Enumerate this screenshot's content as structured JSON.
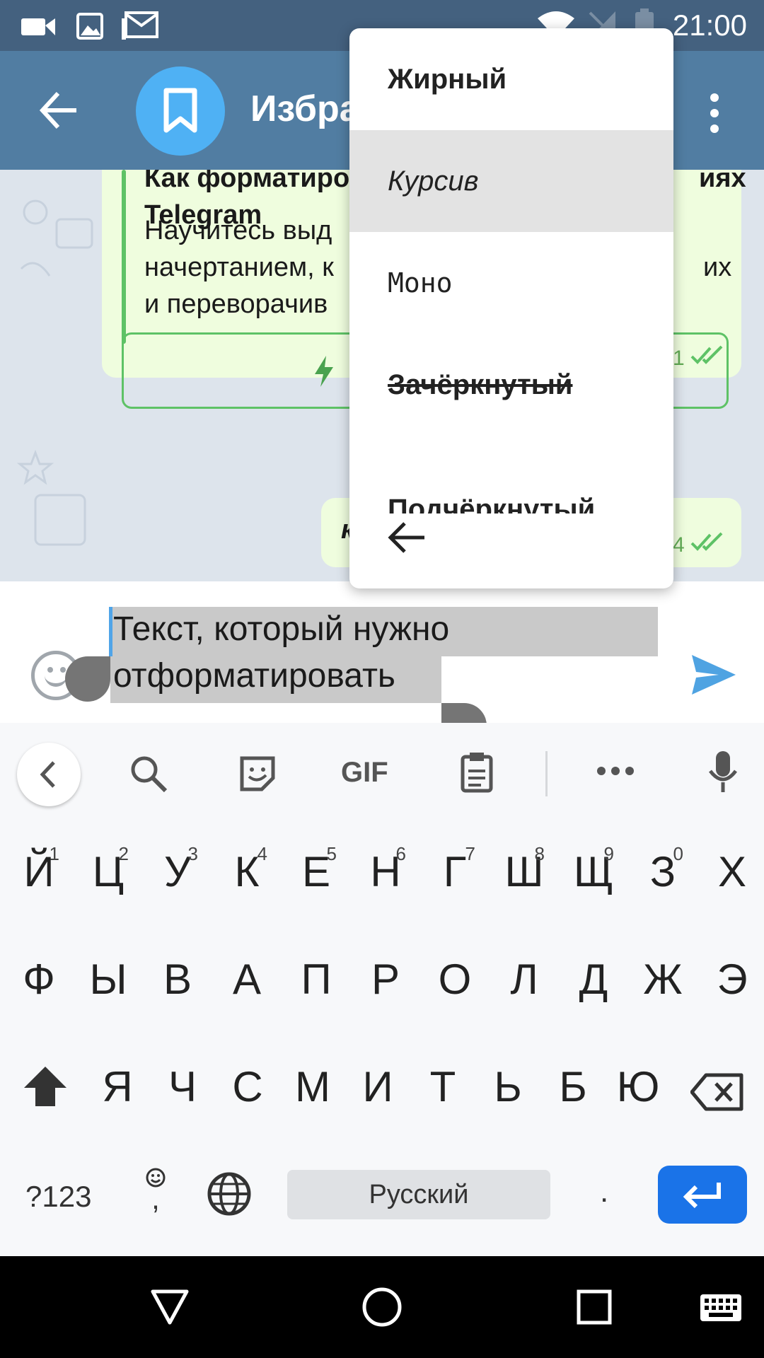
{
  "status_bar": {
    "time": "21:00",
    "icons": [
      "video-camera-icon",
      "image-icon",
      "gmail-icon",
      "wifi-icon",
      "signal-off-icon",
      "battery-icon"
    ]
  },
  "header": {
    "back_icon": "arrow-back-icon",
    "avatar_icon": "bookmark-icon",
    "title": "Избра",
    "menu_icon": "more-vert-icon",
    "colors": {
      "header": "#517da2",
      "status": "#44617f",
      "avatar": "#4fb1f4"
    }
  },
  "chat": {
    "preview_title": "Как форматиро…                   иях\nTelegram",
    "preview_title_line1": "Как форматиро",
    "preview_title_line1_end": "иях",
    "preview_title_line2": "Telegram",
    "preview_desc_lines": [
      "Научитесь выд",
      "начертанием, к",
      "и переворачив"
    ],
    "preview_desc_ends": [
      "",
      "их",
      ""
    ],
    "instant_view_label": "I",
    "msg1_time": "1",
    "msg2_text": "к",
    "msg2_time": "4"
  },
  "input": {
    "line1": "Текст, который нужно",
    "line2": "отформатировать",
    "send_icon": "send-icon",
    "emoji_icon": "emoji-icon"
  },
  "format_menu": {
    "items": [
      {
        "label": "Жирный"
      },
      {
        "label": "Курсив"
      },
      {
        "label": "Моно"
      },
      {
        "label": "Зачёркнутый"
      },
      {
        "label": "Подчёркнутый"
      }
    ],
    "back_icon": "arrow-back-icon"
  },
  "keyboard": {
    "toolbar_icons": [
      "chevron-left-icon",
      "search-icon",
      "sticker-icon",
      "gif-icon",
      "clipboard-icon",
      "more-horiz-icon",
      "mic-icon"
    ],
    "gif_label": "GIF",
    "row1": [
      {
        "key": "Й",
        "hint": "1"
      },
      {
        "key": "Ц",
        "hint": "2"
      },
      {
        "key": "У",
        "hint": "3"
      },
      {
        "key": "К",
        "hint": "4"
      },
      {
        "key": "Е",
        "hint": "5"
      },
      {
        "key": "Н",
        "hint": "6"
      },
      {
        "key": "Г",
        "hint": "7"
      },
      {
        "key": "Ш",
        "hint": "8"
      },
      {
        "key": "Щ",
        "hint": "9"
      },
      {
        "key": "З",
        "hint": "0"
      },
      {
        "key": "Х",
        "hint": ""
      }
    ],
    "row2": [
      "Ф",
      "Ы",
      "В",
      "А",
      "П",
      "Р",
      "О",
      "Л",
      "Д",
      "Ж",
      "Э"
    ],
    "row3": [
      "Я",
      "Ч",
      "С",
      "М",
      "И",
      "Т",
      "Ь",
      "Б",
      "Ю"
    ],
    "symbols_label": "?123",
    "comma_label": ",",
    "space_label": "Русский",
    "period_label": ".",
    "enter_color": "#1a73e8"
  },
  "nav_bar": {
    "icons": [
      "back-triangle-icon",
      "home-circle-icon",
      "recents-square-icon",
      "keyboard-icon"
    ]
  }
}
